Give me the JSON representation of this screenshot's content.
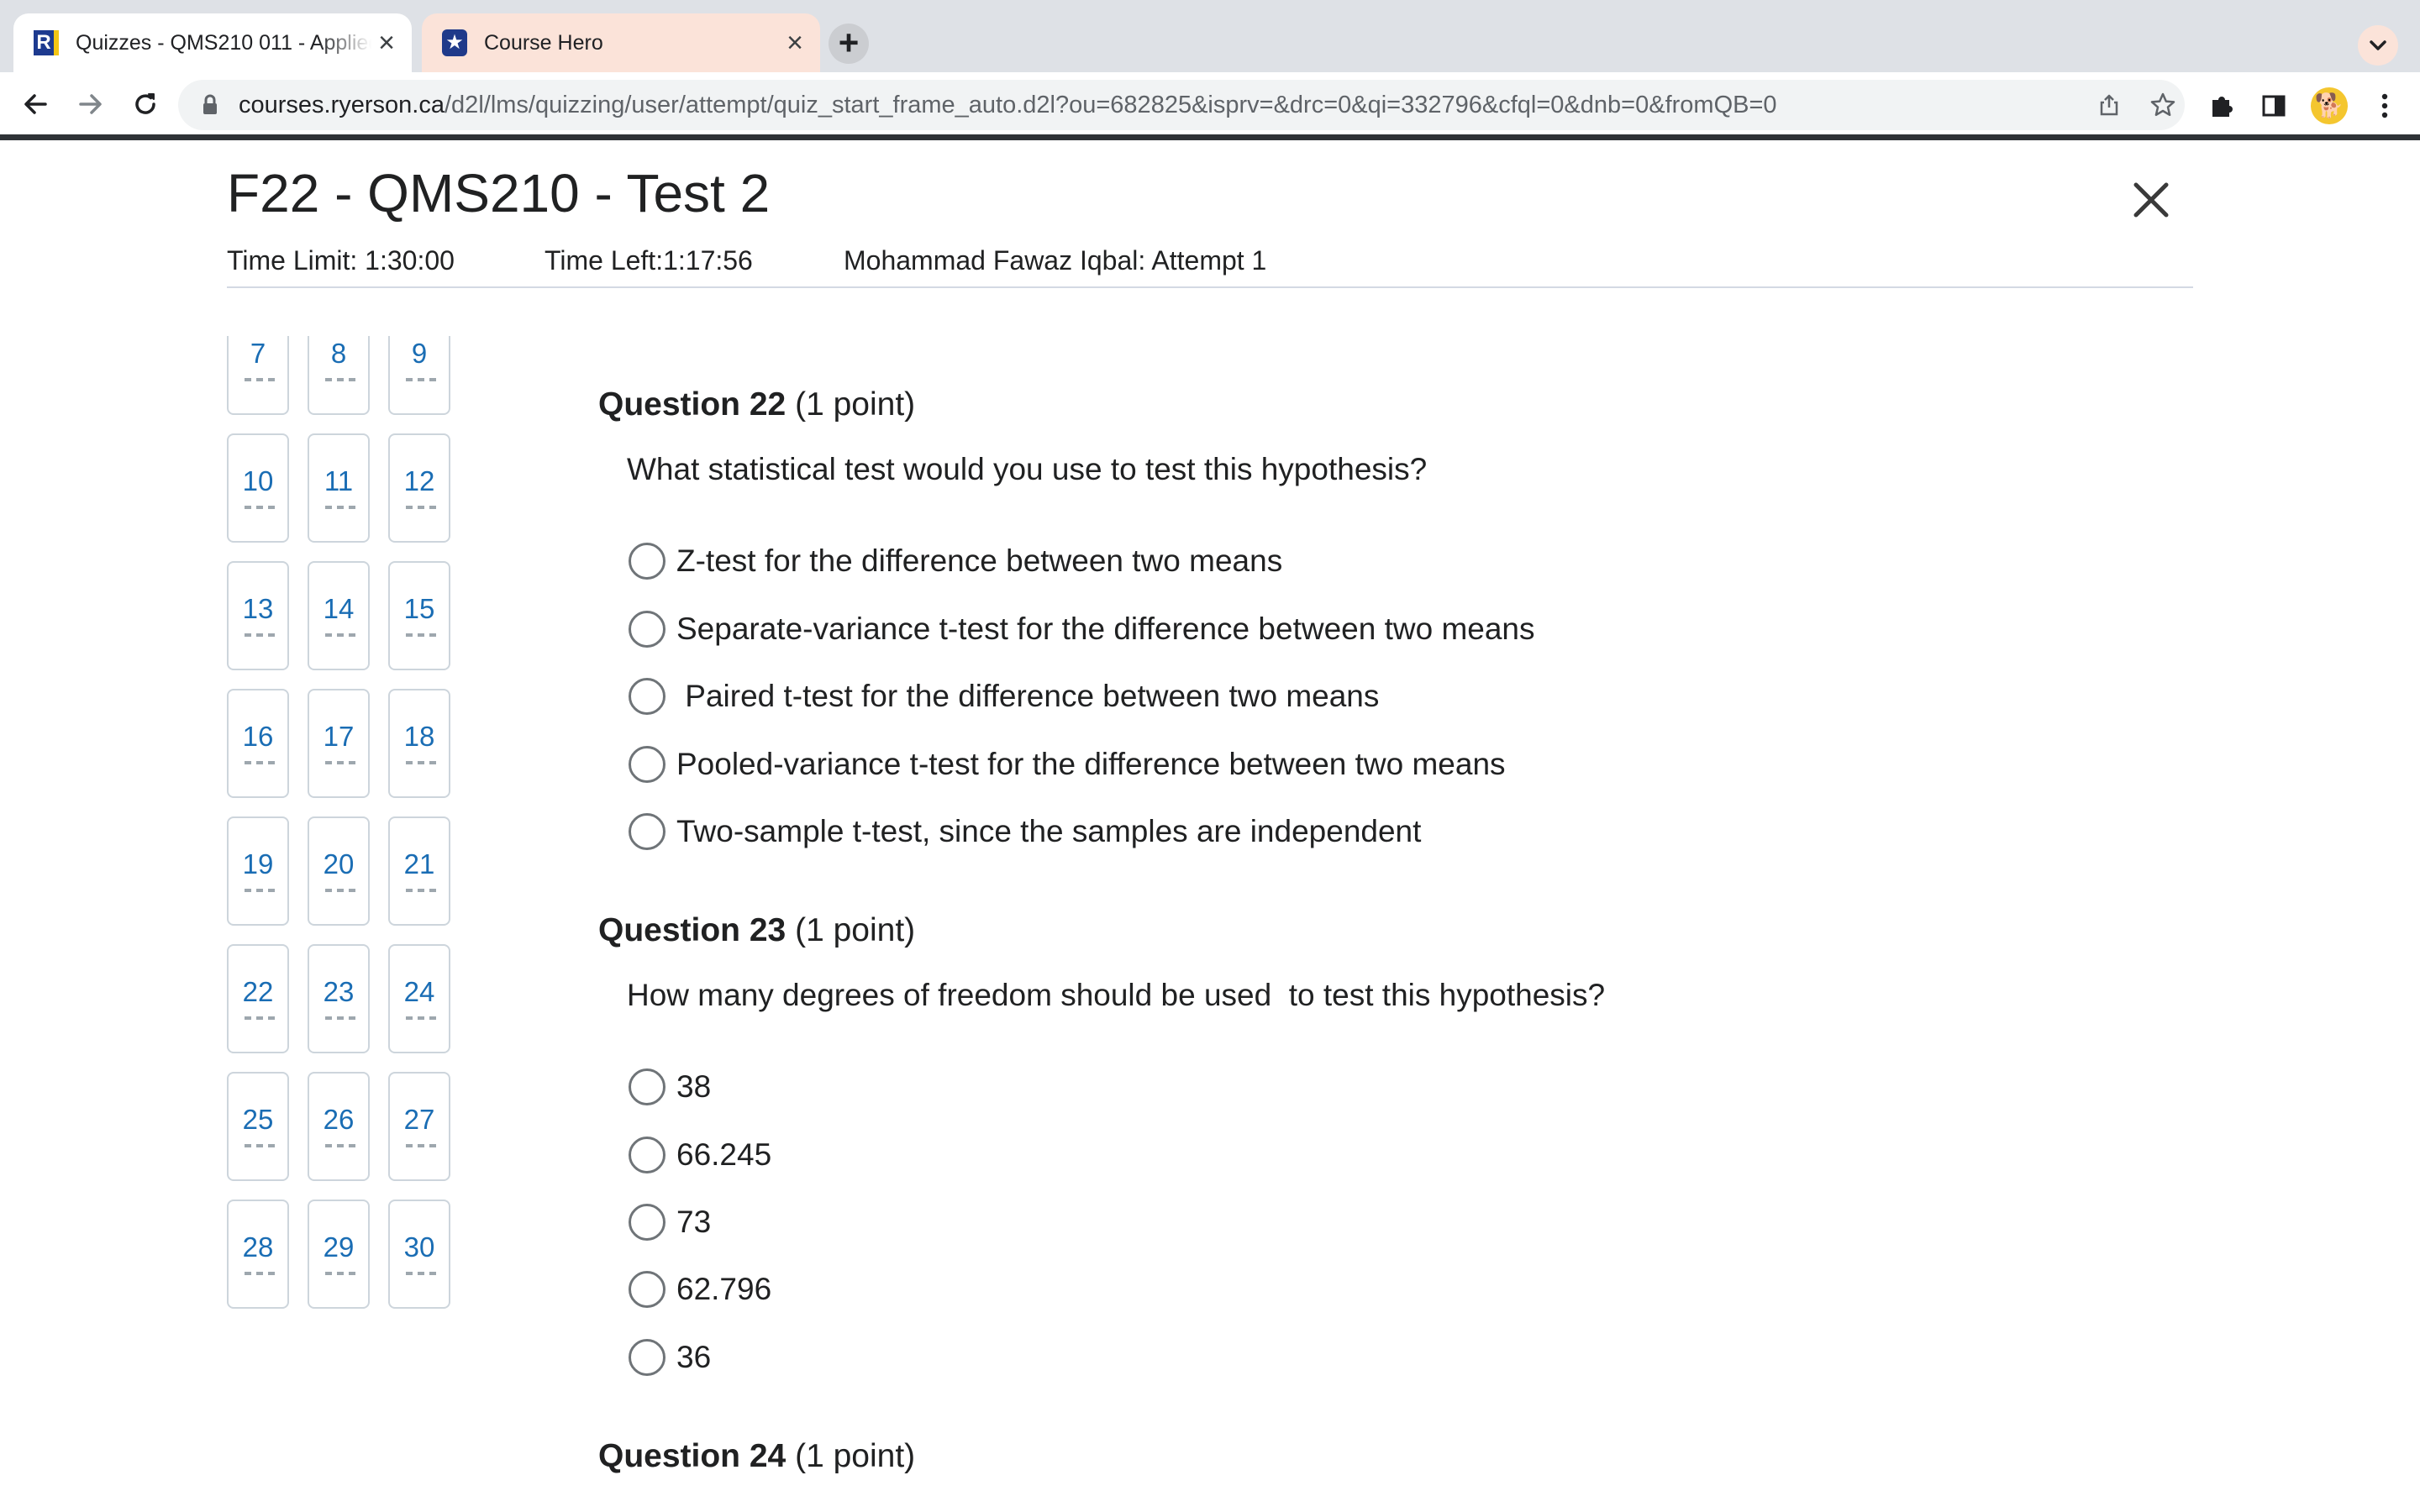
{
  "browser": {
    "tabs": [
      {
        "title": "Quizzes - QMS210 011 - Applied",
        "favicon": "ryerson-r-icon",
        "active": true
      },
      {
        "title": "Course Hero",
        "favicon": "course-hero-icon",
        "active": false
      }
    ],
    "url_host": "courses.ryerson.ca",
    "url_path": "/d2l/lms/quizzing/user/attempt/quiz_start_frame_auto.d2l?ou=682825&isprv=&drc=0&qi=332796&cfql=0&dnb=0&fromQB=0",
    "icons": [
      "back-icon",
      "forward-icon",
      "reload-icon",
      "lock-icon",
      "share-icon",
      "star-icon",
      "extensions-icon",
      "side-panel-icon",
      "profile-avatar",
      "menu-icon"
    ]
  },
  "quiz": {
    "title": "F22 - QMS210 - Test 2",
    "time_limit": "Time Limit: 1:30:00",
    "time_left": "Time Left:1:17:56",
    "attempt": "Mohammad Fawaz Iqbal: Attempt 1"
  },
  "question_nav": [
    "7",
    "8",
    "9",
    "10",
    "11",
    "12",
    "13",
    "14",
    "15",
    "16",
    "17",
    "18",
    "19",
    "20",
    "21",
    "22",
    "23",
    "24",
    "25",
    "26",
    "27",
    "28",
    "29",
    "30"
  ],
  "questions": [
    {
      "title": "Question 22",
      "points": "(1 point)",
      "text": "What statistical test would you use to test this hypothesis?",
      "options": [
        "Z-test for the difference between two means",
        "Separate-variance t-test for the difference between two means",
        " Paired t-test for the difference between two means",
        "Pooled-variance t-test for the difference between two means",
        "Two-sample t-test, since the samples are independent"
      ]
    },
    {
      "title": "Question 23",
      "points": "(1 point)",
      "text": "How many degrees of freedom should be used  to test this hypothesis?",
      "options": [
        "38",
        "66.245",
        "73",
        "62.796",
        "36"
      ]
    },
    {
      "title": "Question 24",
      "points": "(1 point)"
    }
  ]
}
